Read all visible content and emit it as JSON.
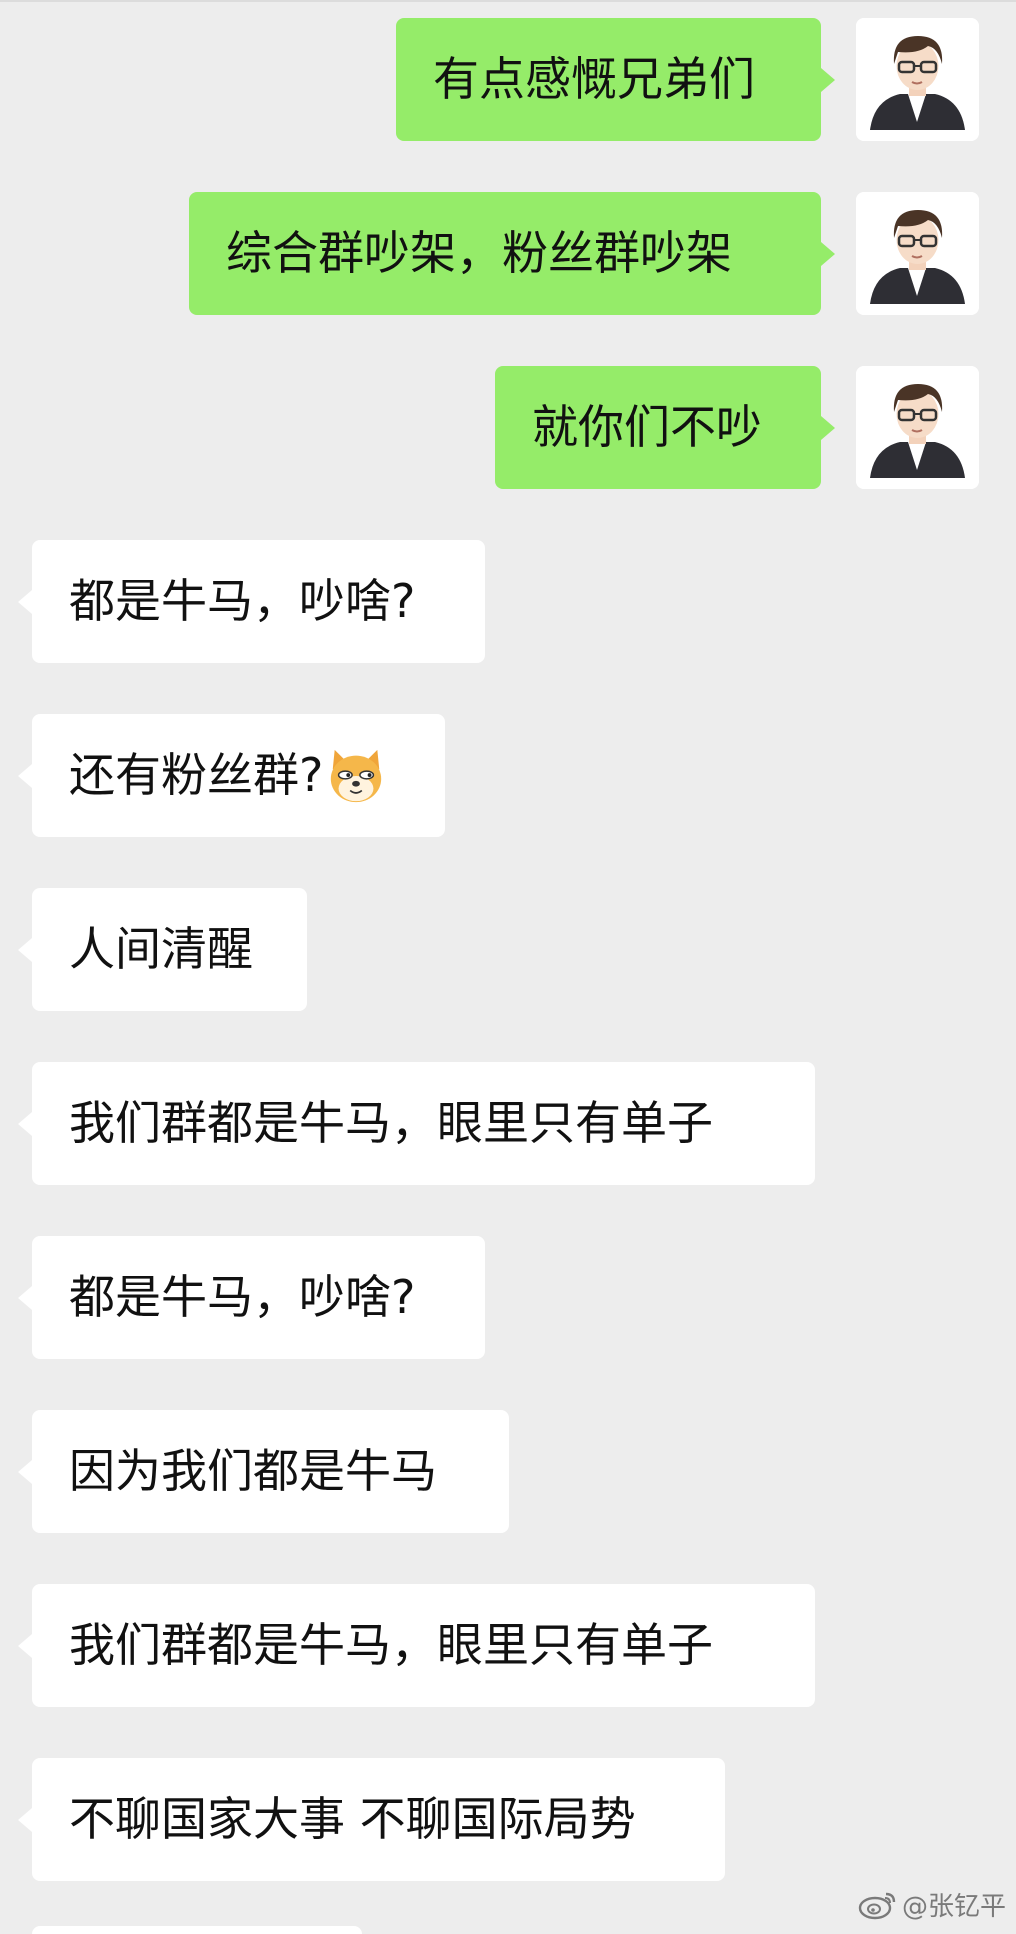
{
  "messages": {
    "outgoing": [
      {
        "text": "有点感慨兄弟们"
      },
      {
        "text": "综合群吵架，粉丝群吵架"
      },
      {
        "text": "就你们不吵"
      }
    ],
    "incoming": [
      {
        "text": "都是牛马，吵啥?"
      },
      {
        "text": "还有粉丝群?"
      },
      {
        "text": "人间清醒"
      },
      {
        "text": "我们群都是牛马，眼里只有单子"
      },
      {
        "text": "都是牛马，吵啥?"
      },
      {
        "text": "因为我们都是牛马"
      },
      {
        "text": "我们群都是牛马，眼里只有单子"
      },
      {
        "text": "不聊国家大事 不聊国际局势"
      }
    ]
  },
  "emoji": {
    "name": "doge-emoji"
  },
  "watermark": {
    "text": "@张钇平",
    "icon": "weibo-icon"
  },
  "colors": {
    "background": "#ededed",
    "outgoing_bubble": "#95ec69",
    "incoming_bubble": "#ffffff"
  }
}
